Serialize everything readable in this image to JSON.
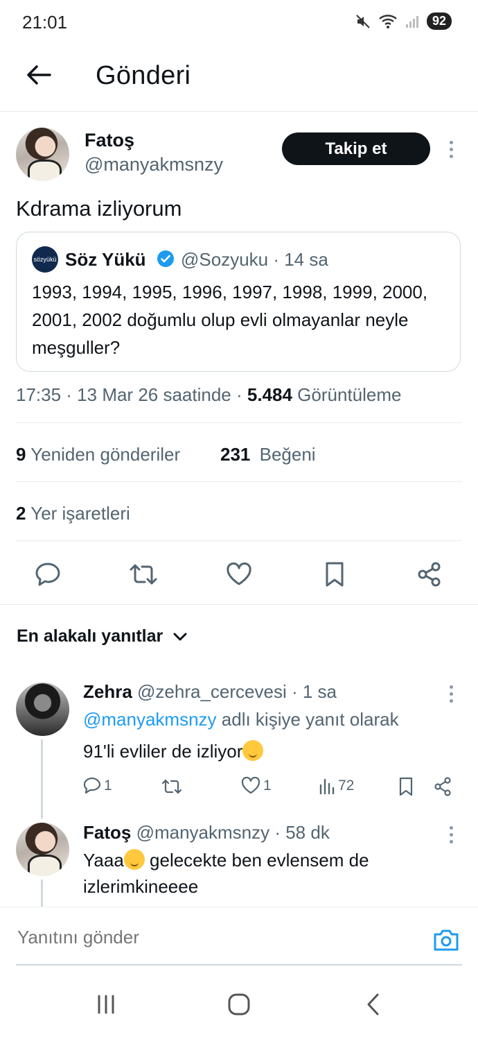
{
  "status_bar": {
    "time": "21:01",
    "battery": "92"
  },
  "header": {
    "title": "Gönderi"
  },
  "tweet": {
    "author_name": "Fatoş",
    "author_handle": "@manyakmsnzy",
    "follow_label": "Takip et",
    "text": "Kdrama izliyorum",
    "quoted": {
      "name": "Söz Yükü",
      "handle_time": "@Sozyuku · 14 sa",
      "avatar_text": "sözyükü",
      "text": "1993, 1994, 1995, 1996, 1997, 1998, 1999, 2000, 2001, 2002 doğumlu olup evli olmayanlar neyle meşguller?"
    },
    "timestamp": "17:35 · 13 Mar 26 saatinde · ",
    "views_count": "5.484",
    "views_label": " Görüntüleme",
    "reposts_count": "9",
    "reposts_label": "Yeniden gönderiler",
    "likes_count": "231",
    "likes_label": "Beğeni",
    "bookmarks_count": "2",
    "bookmarks_label": "Yer işaretleri"
  },
  "replies_section": {
    "title": "En alakalı yanıtlar"
  },
  "replies": [
    {
      "name": "Zehra",
      "handle_time": " @zehra_cercevesi · 1 sa",
      "reply_to_handle": "@manyakmsnzy",
      "reply_to_suffix": " adlı kişiye yanıt olarak",
      "text": "91'li evliler de izliyor",
      "reply_count": "1",
      "like_count": "1",
      "view_count": "72"
    },
    {
      "name": "Fatoş",
      "handle_time": " @manyakmsnzy · 58 dk",
      "text_line1": "Yaaa",
      "text_line1_rest": " gelecekte ben evlensem de",
      "text_line2": "izlerimkineeee"
    }
  ],
  "composer": {
    "placeholder": "Yanıtını gönder"
  }
}
